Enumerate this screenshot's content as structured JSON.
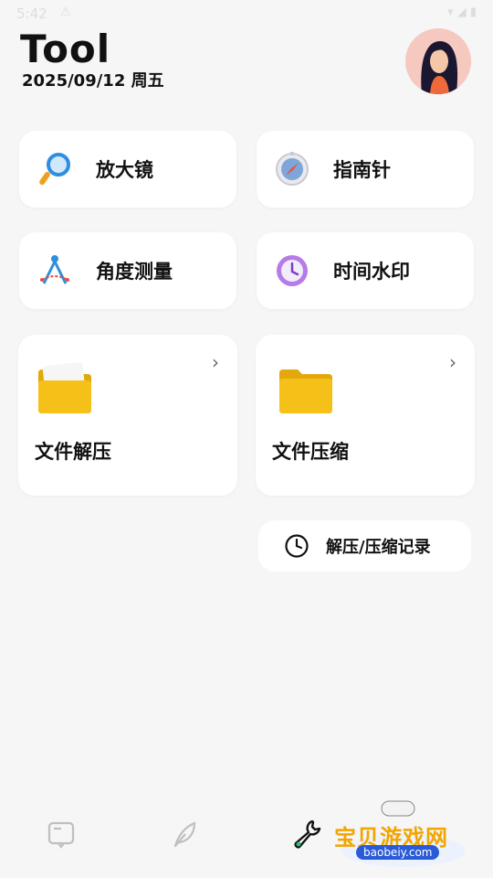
{
  "status_bar": {
    "time": "5:42",
    "warning_icon": "warning-icon",
    "icons": [
      "wifi-icon",
      "signal-icon",
      "battery-icon"
    ]
  },
  "header": {
    "title": "Tool",
    "date": "2025/09/12 周五"
  },
  "tools": [
    {
      "label": "放大镜",
      "icon": "magnifier-icon"
    },
    {
      "label": "指南针",
      "icon": "compass-icon"
    },
    {
      "label": "角度测量",
      "icon": "protractor-icon"
    },
    {
      "label": "时间水印",
      "icon": "clock-watermark-icon"
    }
  ],
  "files": [
    {
      "label": "文件解压",
      "icon": "folder-open-icon"
    },
    {
      "label": "文件压缩",
      "icon": "folder-icon"
    }
  ],
  "history": {
    "label": "解压/压缩记录"
  },
  "watermark": {
    "text": "宝贝游戏网",
    "sub": "baobeiy.com"
  },
  "colors": {
    "background": "#f6f6f6",
    "card": "#ffffff",
    "folder": "#f5c118",
    "accent": "#9b59d9"
  }
}
